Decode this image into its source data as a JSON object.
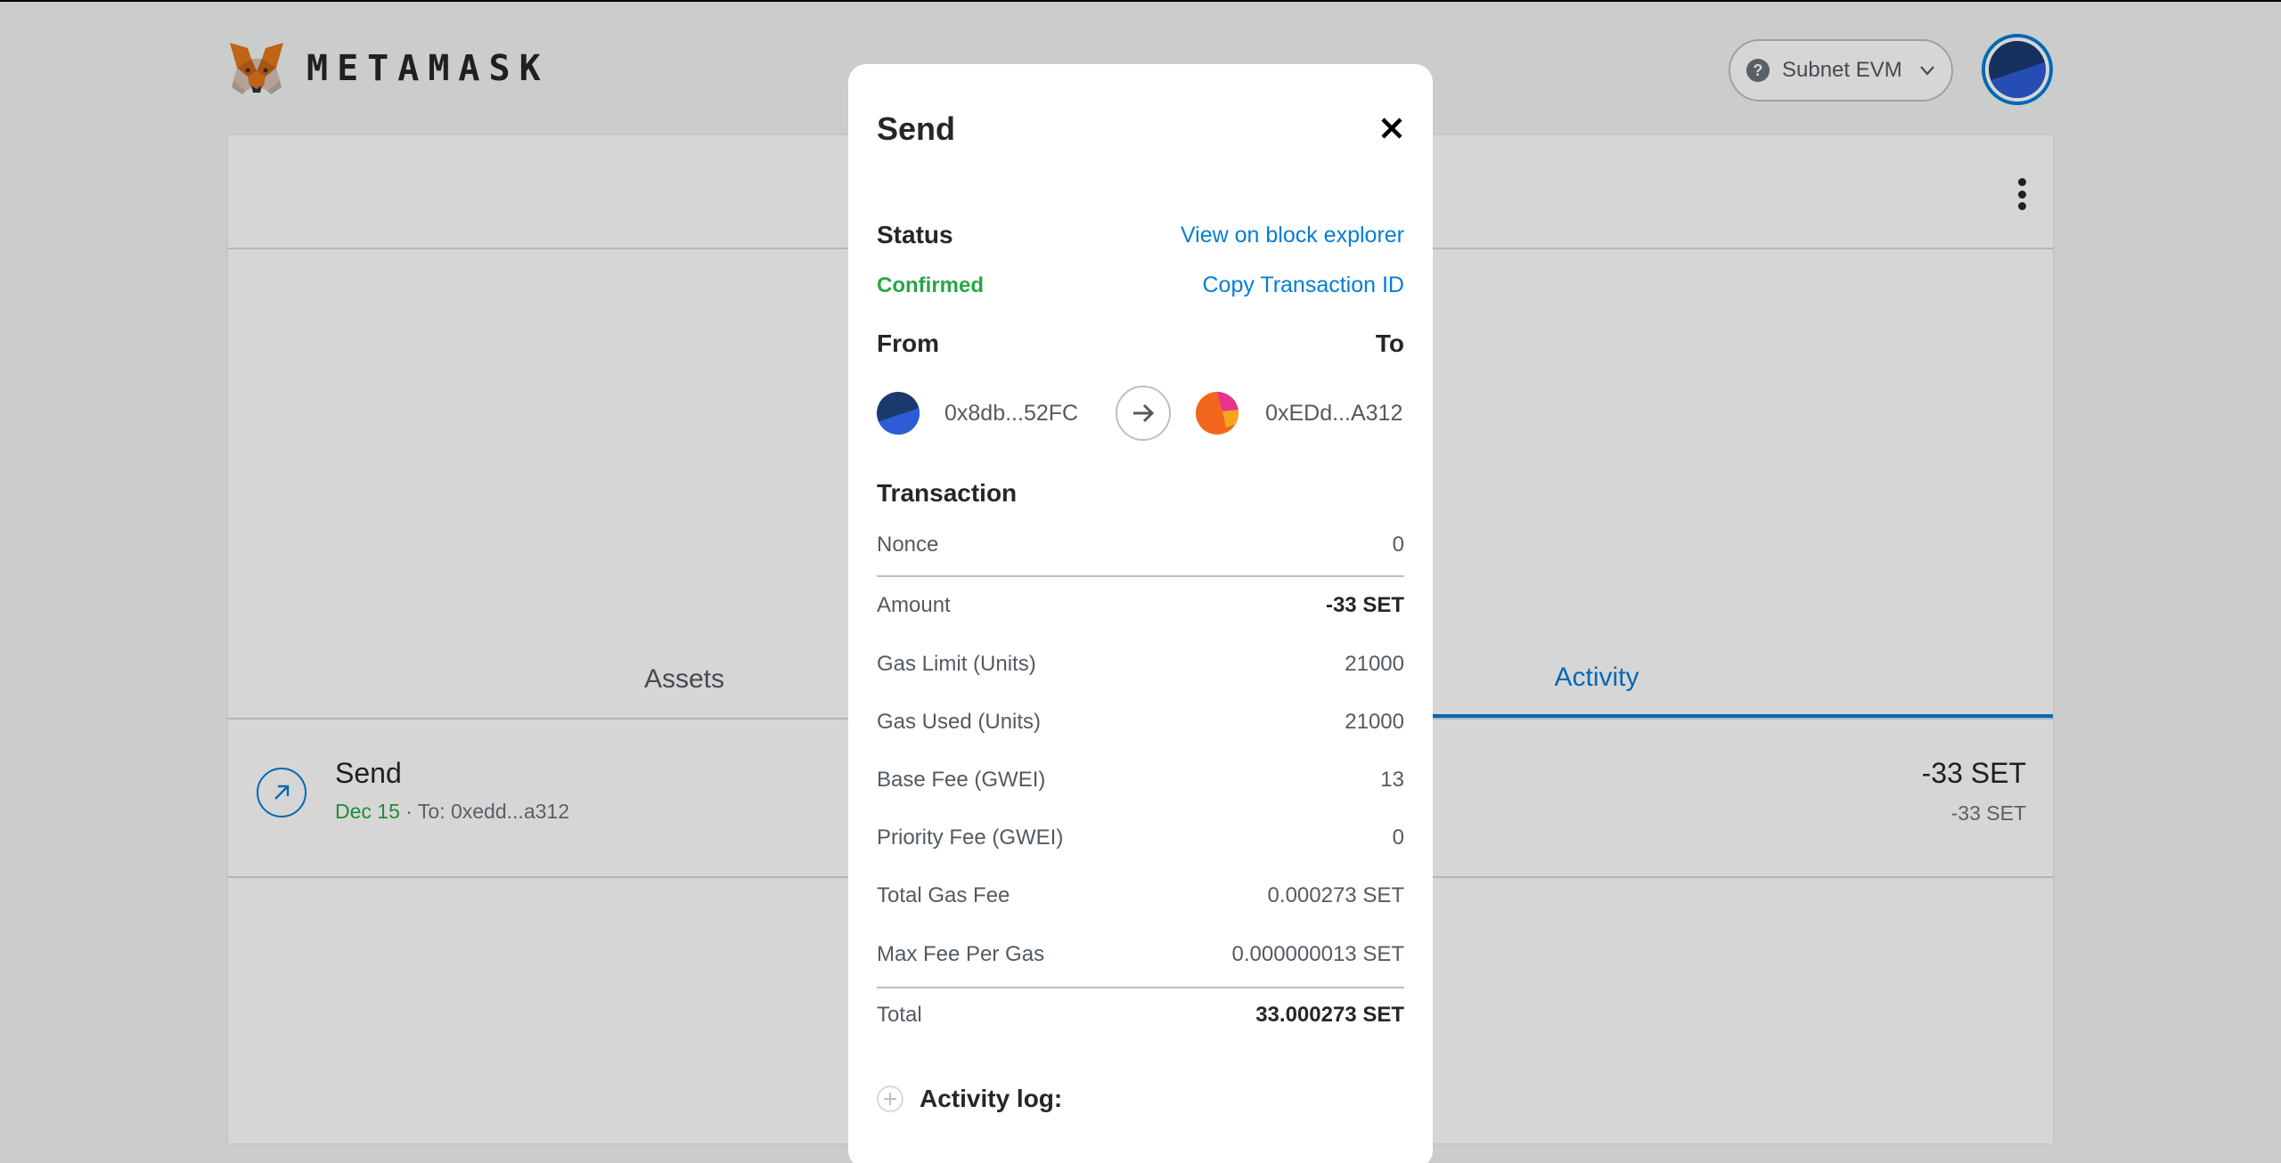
{
  "app": {
    "brand": "METAMASK"
  },
  "network": {
    "label": "Subnet EVM"
  },
  "tabs": [
    {
      "label": "Assets",
      "active": false
    },
    {
      "label": "Activity",
      "active": true
    }
  ],
  "activity": {
    "title": "Send",
    "date": "Dec 15",
    "separator": " · ",
    "to": "To: 0xedd...a312",
    "amount": "-33 SET",
    "amount_secondary": "-33 SET"
  },
  "modal": {
    "title": "Send",
    "status_label": "Status",
    "status_value": "Confirmed",
    "view_explorer": "View on block explorer",
    "copy_tx_id": "Copy Transaction ID",
    "from_label": "From",
    "to_label": "To",
    "from_address": "0x8db...52FC",
    "to_address": "0xEDd...A312",
    "transaction_label": "Transaction",
    "details": [
      {
        "label": "Nonce",
        "value": "0"
      },
      {
        "label": "Amount",
        "value": "-33 SET"
      },
      {
        "label": "Gas Limit (Units)",
        "value": "21000"
      },
      {
        "label": "Gas Used (Units)",
        "value": "21000"
      },
      {
        "label": "Base Fee (GWEI)",
        "value": "13"
      },
      {
        "label": "Priority Fee (GWEI)",
        "value": "0"
      },
      {
        "label": "Total Gas Fee",
        "value": "0.000273 SET"
      },
      {
        "label": "Max Fee Per Gas",
        "value": "0.000000013 SET"
      },
      {
        "label": "Total",
        "value": "33.000273 SET"
      }
    ],
    "activity_log_label": "Activity log:"
  },
  "colors": {
    "accent": "#037dd6",
    "success": "#28a745",
    "text": "#24272a",
    "muted": "#535a61"
  },
  "icons": {
    "brand": "metamask-fox-icon",
    "network_help": "question-icon",
    "network_dropdown": "chevron-down-icon",
    "menu": "kebab-menu-icon",
    "activity_send": "arrow-up-right-icon",
    "close": "close-icon",
    "from_to": "arrow-right-icon",
    "activity_log": "plus-icon"
  }
}
